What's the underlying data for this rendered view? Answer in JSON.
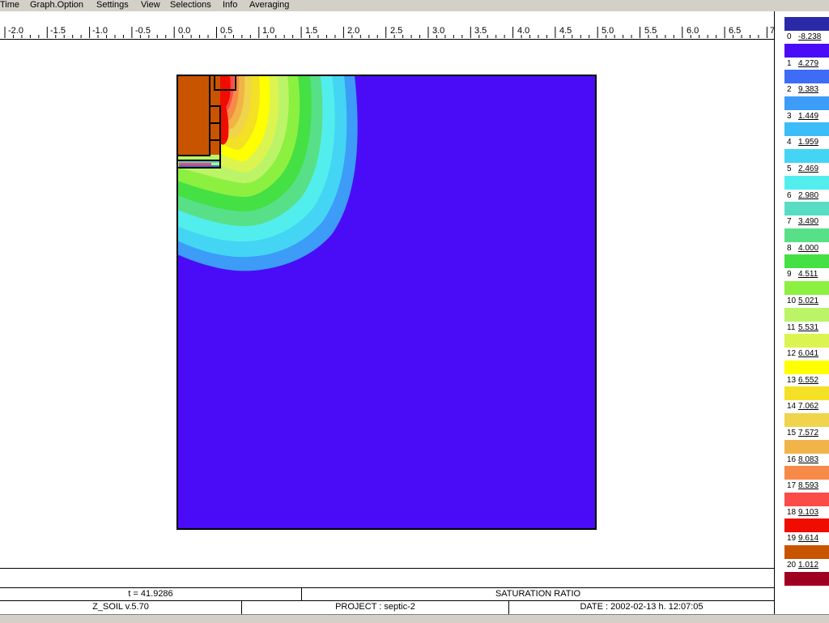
{
  "menu": [
    "Time",
    "Graph.Option",
    "Settings",
    "View",
    "Selections",
    "Info",
    "Averaging"
  ],
  "ruler": {
    "labels": [
      "-2.0",
      "-1.5",
      "-1.0",
      "-0.5",
      "0.0",
      "0.5",
      "1.0",
      "1.5",
      "2.0",
      "2.5",
      "3.0",
      "3.5",
      "4.0",
      "4.5",
      "5.0",
      "5.5",
      "6.0",
      "6.5",
      "7"
    ]
  },
  "legend": {
    "entries": [
      {
        "index": "0",
        "value": "-8.238"
      },
      {
        "index": "1",
        "value": "4.279"
      },
      {
        "index": "2",
        "value": "9.383"
      },
      {
        "index": "3",
        "value": "1.449"
      },
      {
        "index": "4",
        "value": "1.959"
      },
      {
        "index": "5",
        "value": "2.469"
      },
      {
        "index": "6",
        "value": "2.980"
      },
      {
        "index": "7",
        "value": "3.490"
      },
      {
        "index": "8",
        "value": "4.000"
      },
      {
        "index": "9",
        "value": "4.511"
      },
      {
        "index": "10",
        "value": "5.021"
      },
      {
        "index": "11",
        "value": "5.531"
      },
      {
        "index": "12",
        "value": "6.041"
      },
      {
        "index": "13",
        "value": "6.552"
      },
      {
        "index": "14",
        "value": "7.062"
      },
      {
        "index": "15",
        "value": "7.572"
      },
      {
        "index": "16",
        "value": "8.083"
      },
      {
        "index": "17",
        "value": "8.593"
      },
      {
        "index": "18",
        "value": "9.103"
      },
      {
        "index": "19",
        "value": "9.614"
      },
      {
        "index": "20",
        "value": "1.012"
      }
    ],
    "colors": [
      "#2a2aa8",
      "#4a0cf6",
      "#3f6cf6",
      "#3c9cf8",
      "#3cbcf8",
      "#44d4f4",
      "#52eeee",
      "#58dcc4",
      "#58e088",
      "#44e044",
      "#8cf040",
      "#bcf468",
      "#dcf450",
      "#ffff00",
      "#f4e024",
      "#f0d44c",
      "#f0b448",
      "#f88a48",
      "#fc4c48",
      "#f00c00",
      "#c85400",
      "#a00020"
    ]
  },
  "footer": {
    "time": "t = 41.9286",
    "quantity": "SATURATION RATIO",
    "version": "Z_SOIL v.5.70",
    "project": "PROJECT : septic-2",
    "date": "DATE : 2002-02-13  h. 12:07:05"
  }
}
